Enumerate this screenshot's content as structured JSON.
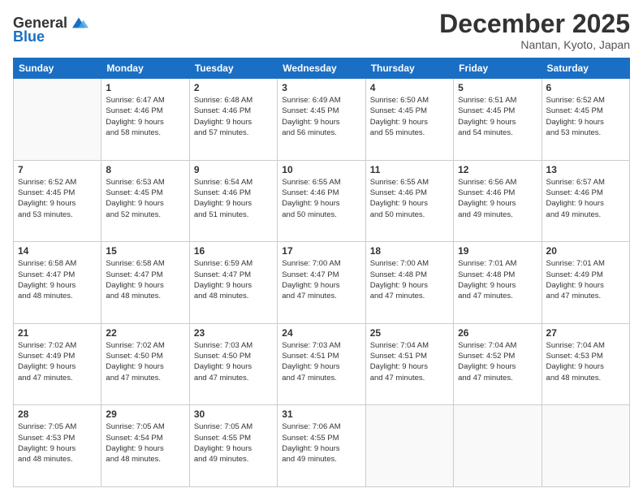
{
  "header": {
    "logo_general": "General",
    "logo_blue": "Blue",
    "month_title": "December 2025",
    "location": "Nantan, Kyoto, Japan"
  },
  "days_of_week": [
    "Sunday",
    "Monday",
    "Tuesday",
    "Wednesday",
    "Thursday",
    "Friday",
    "Saturday"
  ],
  "weeks": [
    [
      {
        "day": "",
        "info": ""
      },
      {
        "day": "1",
        "info": "Sunrise: 6:47 AM\nSunset: 4:46 PM\nDaylight: 9 hours\nand 58 minutes."
      },
      {
        "day": "2",
        "info": "Sunrise: 6:48 AM\nSunset: 4:46 PM\nDaylight: 9 hours\nand 57 minutes."
      },
      {
        "day": "3",
        "info": "Sunrise: 6:49 AM\nSunset: 4:45 PM\nDaylight: 9 hours\nand 56 minutes."
      },
      {
        "day": "4",
        "info": "Sunrise: 6:50 AM\nSunset: 4:45 PM\nDaylight: 9 hours\nand 55 minutes."
      },
      {
        "day": "5",
        "info": "Sunrise: 6:51 AM\nSunset: 4:45 PM\nDaylight: 9 hours\nand 54 minutes."
      },
      {
        "day": "6",
        "info": "Sunrise: 6:52 AM\nSunset: 4:45 PM\nDaylight: 9 hours\nand 53 minutes."
      }
    ],
    [
      {
        "day": "7",
        "info": "Sunrise: 6:52 AM\nSunset: 4:45 PM\nDaylight: 9 hours\nand 53 minutes."
      },
      {
        "day": "8",
        "info": "Sunrise: 6:53 AM\nSunset: 4:45 PM\nDaylight: 9 hours\nand 52 minutes."
      },
      {
        "day": "9",
        "info": "Sunrise: 6:54 AM\nSunset: 4:46 PM\nDaylight: 9 hours\nand 51 minutes."
      },
      {
        "day": "10",
        "info": "Sunrise: 6:55 AM\nSunset: 4:46 PM\nDaylight: 9 hours\nand 50 minutes."
      },
      {
        "day": "11",
        "info": "Sunrise: 6:55 AM\nSunset: 4:46 PM\nDaylight: 9 hours\nand 50 minutes."
      },
      {
        "day": "12",
        "info": "Sunrise: 6:56 AM\nSunset: 4:46 PM\nDaylight: 9 hours\nand 49 minutes."
      },
      {
        "day": "13",
        "info": "Sunrise: 6:57 AM\nSunset: 4:46 PM\nDaylight: 9 hours\nand 49 minutes."
      }
    ],
    [
      {
        "day": "14",
        "info": "Sunrise: 6:58 AM\nSunset: 4:47 PM\nDaylight: 9 hours\nand 48 minutes."
      },
      {
        "day": "15",
        "info": "Sunrise: 6:58 AM\nSunset: 4:47 PM\nDaylight: 9 hours\nand 48 minutes."
      },
      {
        "day": "16",
        "info": "Sunrise: 6:59 AM\nSunset: 4:47 PM\nDaylight: 9 hours\nand 48 minutes."
      },
      {
        "day": "17",
        "info": "Sunrise: 7:00 AM\nSunset: 4:47 PM\nDaylight: 9 hours\nand 47 minutes."
      },
      {
        "day": "18",
        "info": "Sunrise: 7:00 AM\nSunset: 4:48 PM\nDaylight: 9 hours\nand 47 minutes."
      },
      {
        "day": "19",
        "info": "Sunrise: 7:01 AM\nSunset: 4:48 PM\nDaylight: 9 hours\nand 47 minutes."
      },
      {
        "day": "20",
        "info": "Sunrise: 7:01 AM\nSunset: 4:49 PM\nDaylight: 9 hours\nand 47 minutes."
      }
    ],
    [
      {
        "day": "21",
        "info": "Sunrise: 7:02 AM\nSunset: 4:49 PM\nDaylight: 9 hours\nand 47 minutes."
      },
      {
        "day": "22",
        "info": "Sunrise: 7:02 AM\nSunset: 4:50 PM\nDaylight: 9 hours\nand 47 minutes."
      },
      {
        "day": "23",
        "info": "Sunrise: 7:03 AM\nSunset: 4:50 PM\nDaylight: 9 hours\nand 47 minutes."
      },
      {
        "day": "24",
        "info": "Sunrise: 7:03 AM\nSunset: 4:51 PM\nDaylight: 9 hours\nand 47 minutes."
      },
      {
        "day": "25",
        "info": "Sunrise: 7:04 AM\nSunset: 4:51 PM\nDaylight: 9 hours\nand 47 minutes."
      },
      {
        "day": "26",
        "info": "Sunrise: 7:04 AM\nSunset: 4:52 PM\nDaylight: 9 hours\nand 47 minutes."
      },
      {
        "day": "27",
        "info": "Sunrise: 7:04 AM\nSunset: 4:53 PM\nDaylight: 9 hours\nand 48 minutes."
      }
    ],
    [
      {
        "day": "28",
        "info": "Sunrise: 7:05 AM\nSunset: 4:53 PM\nDaylight: 9 hours\nand 48 minutes."
      },
      {
        "day": "29",
        "info": "Sunrise: 7:05 AM\nSunset: 4:54 PM\nDaylight: 9 hours\nand 48 minutes."
      },
      {
        "day": "30",
        "info": "Sunrise: 7:05 AM\nSunset: 4:55 PM\nDaylight: 9 hours\nand 49 minutes."
      },
      {
        "day": "31",
        "info": "Sunrise: 7:06 AM\nSunset: 4:55 PM\nDaylight: 9 hours\nand 49 minutes."
      },
      {
        "day": "",
        "info": ""
      },
      {
        "day": "",
        "info": ""
      },
      {
        "day": "",
        "info": ""
      }
    ]
  ]
}
